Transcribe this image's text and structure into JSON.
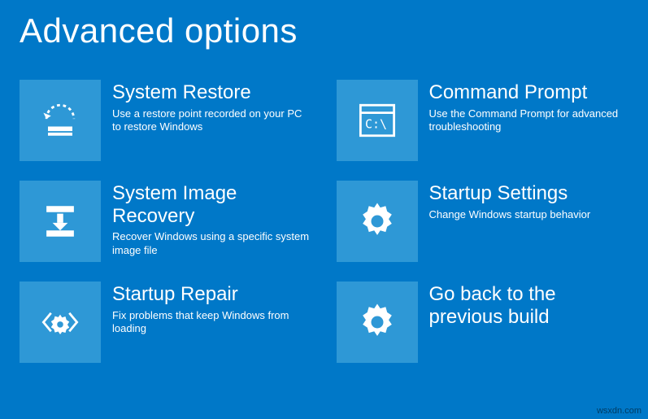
{
  "title": "Advanced options",
  "tiles": [
    {
      "id": "system-restore",
      "icon": "restore",
      "title": "System Restore",
      "desc": "Use a restore point recorded on your PC to restore Windows"
    },
    {
      "id": "command-prompt",
      "icon": "cmd",
      "title": "Command Prompt",
      "desc": "Use the Command Prompt for advanced troubleshooting"
    },
    {
      "id": "system-image-recovery",
      "icon": "image-recovery",
      "title": "System Image Recovery",
      "desc": "Recover Windows using a specific system image file"
    },
    {
      "id": "startup-settings",
      "icon": "gear",
      "title": "Startup Settings",
      "desc": "Change Windows startup behavior"
    },
    {
      "id": "startup-repair",
      "icon": "repair",
      "title": "Startup Repair",
      "desc": "Fix problems that keep Windows from loading"
    },
    {
      "id": "go-back-previous-build",
      "icon": "gear",
      "title": "Go back to the previous build",
      "desc": ""
    }
  ],
  "watermark": "wsxdn.com"
}
